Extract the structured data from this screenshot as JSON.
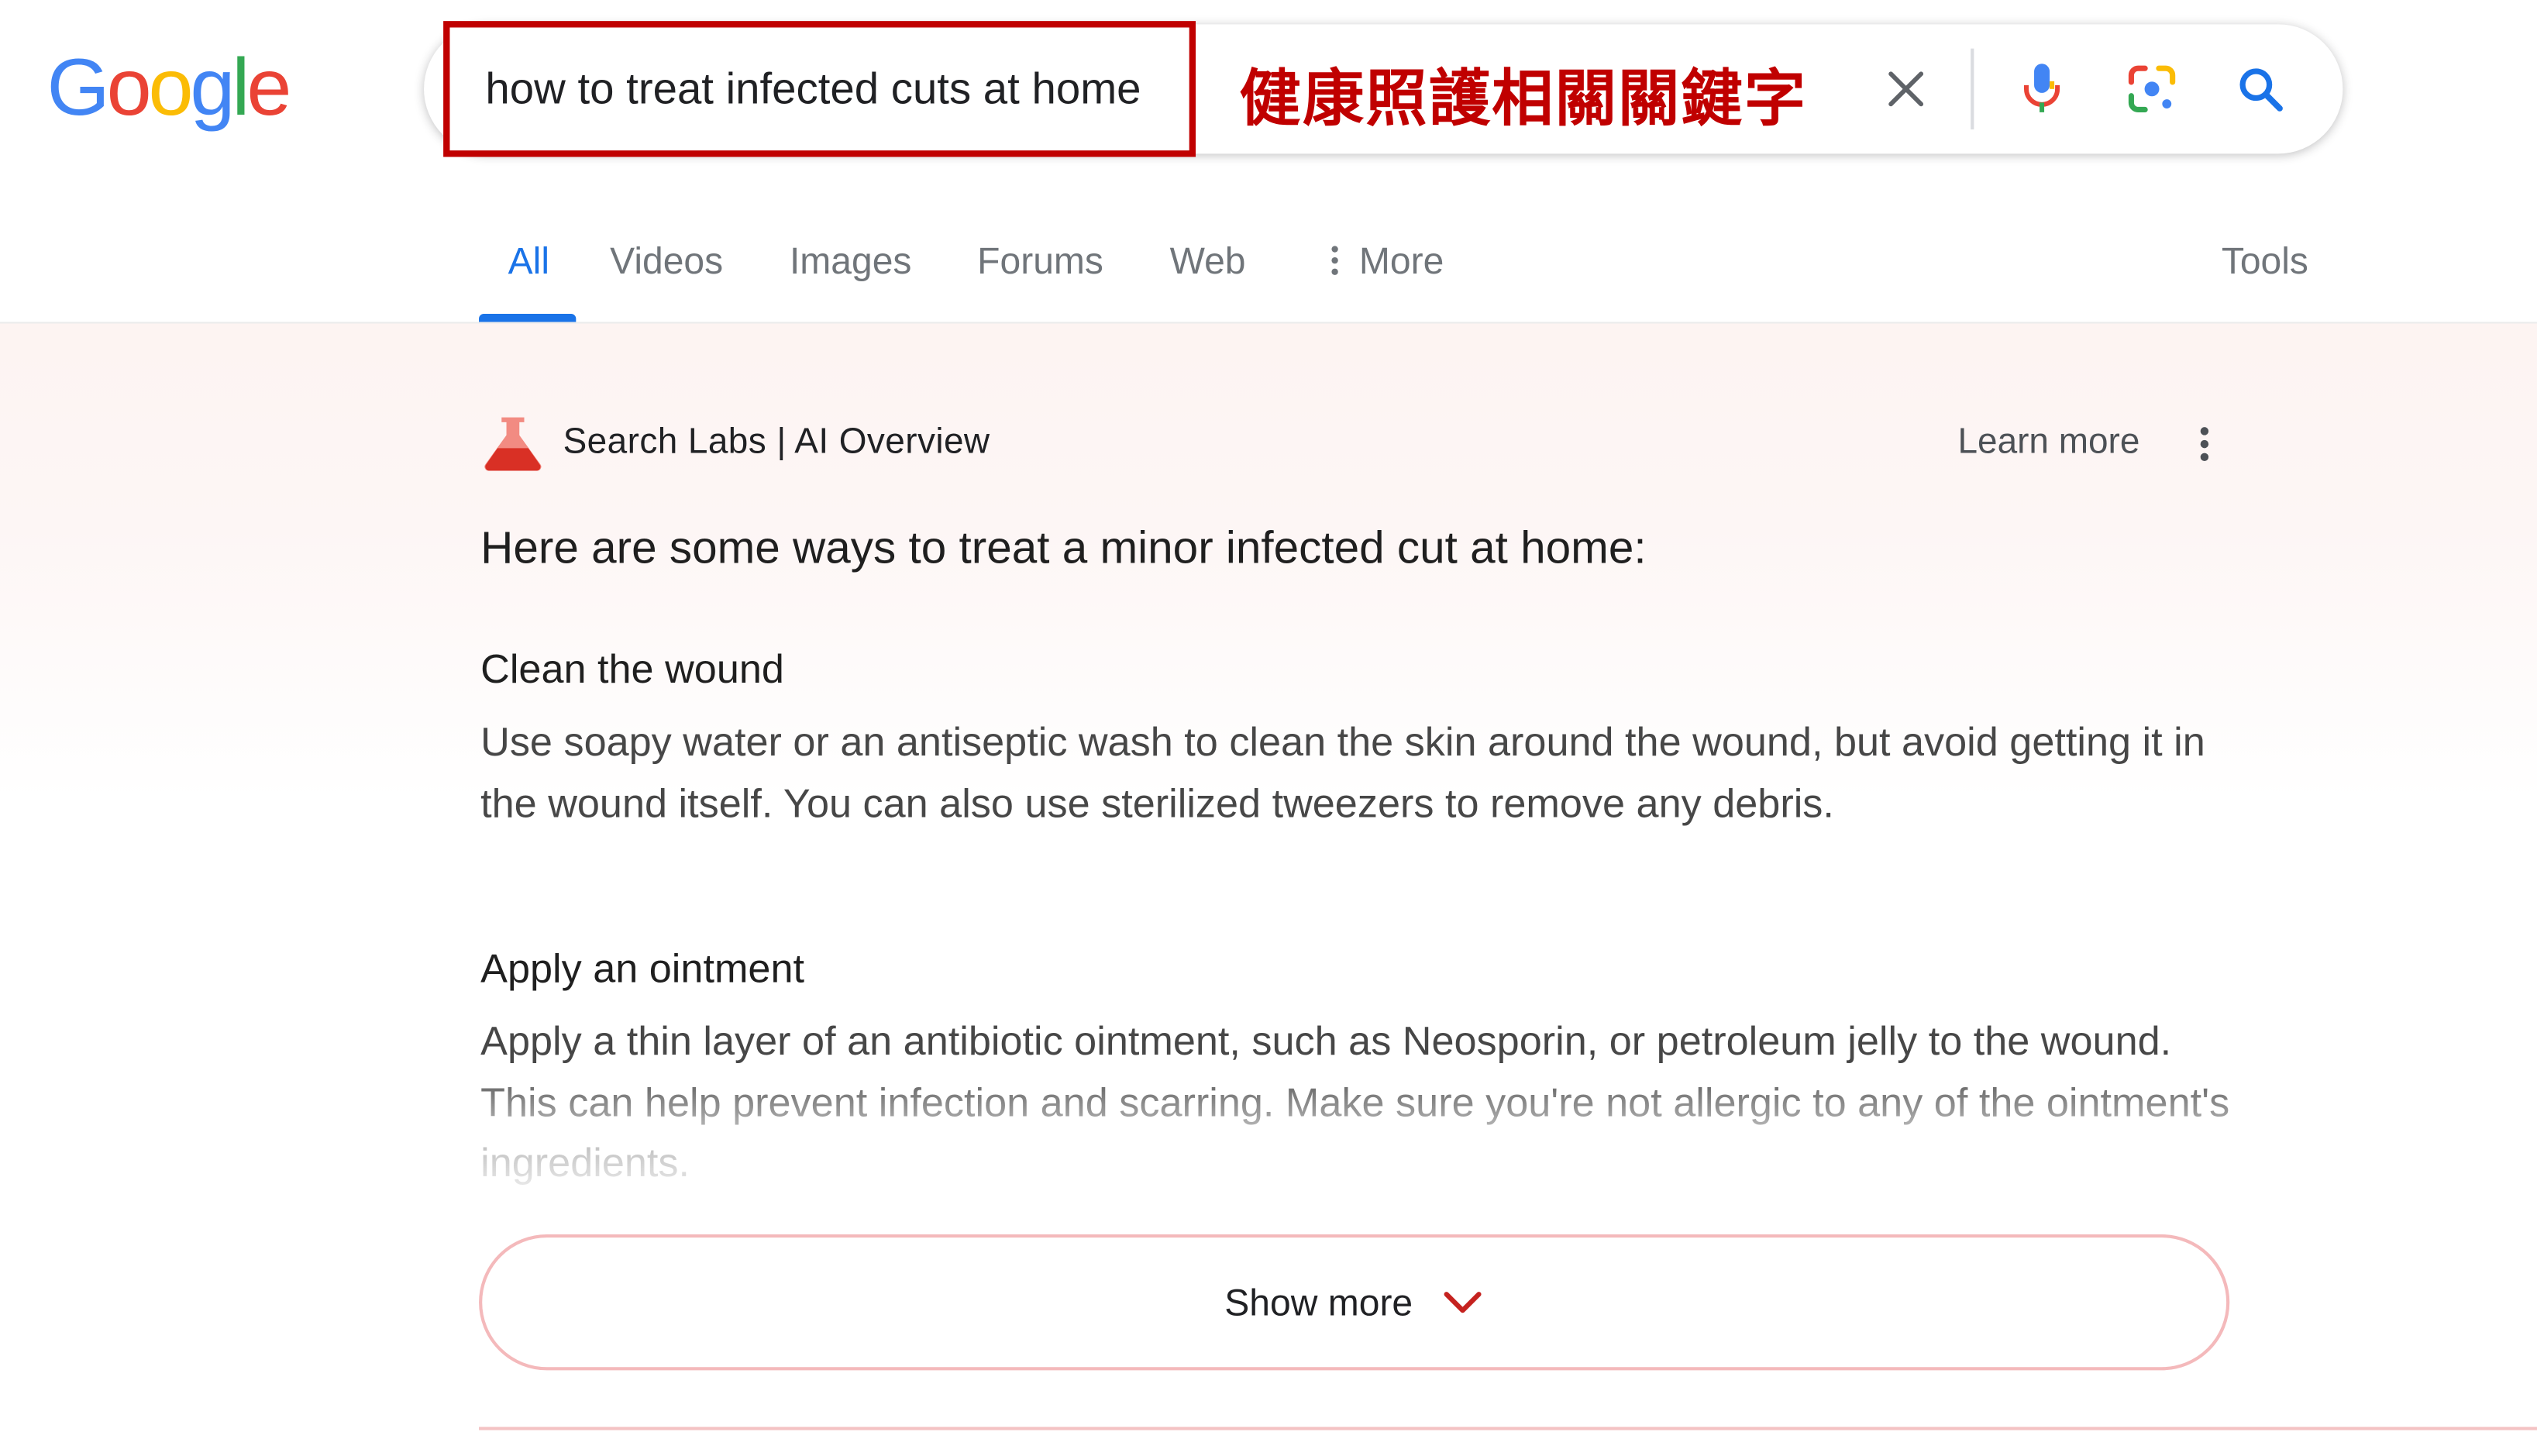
{
  "logo": {
    "text": "Google",
    "colors": [
      "#4285F4",
      "#EA4335",
      "#FBBC05",
      "#4285F4",
      "#34A853",
      "#EA4335"
    ]
  },
  "search": {
    "query": "how to treat infected cuts at home",
    "annotation": "健康照護相關關鍵字",
    "icons": [
      "close-icon",
      "mic-icon",
      "lens-icon",
      "search-icon"
    ]
  },
  "tabs": {
    "items": [
      "All",
      "Videos",
      "Images",
      "Forums",
      "Web",
      "More"
    ],
    "active": "All",
    "tools": "Tools"
  },
  "ai_overview": {
    "title": "Search Labs | AI Overview",
    "learn_more": "Learn more",
    "intro": "Here are some ways to treat a minor infected cut at home:",
    "sections": [
      {
        "heading": "Clean the wound",
        "body": "Use soapy water or an antiseptic wash to clean the skin around the wound, but avoid getting it in the wound itself. You can also use sterilized tweezers to remove any debris."
      },
      {
        "heading": "Apply an ointment",
        "body": "Apply a thin layer of an antibiotic ointment, such as Neosporin, or petroleum jelly to the wound. This can help prevent infection and scarring. Make sure you're not allergic to any of the ointment's ingredients."
      }
    ],
    "show_more": "Show more"
  },
  "colors": {
    "accent_blue": "#1a73e8",
    "annotation_red": "#c00000",
    "flask_red": "#e8554e",
    "border_pink": "#f4b9bb"
  }
}
